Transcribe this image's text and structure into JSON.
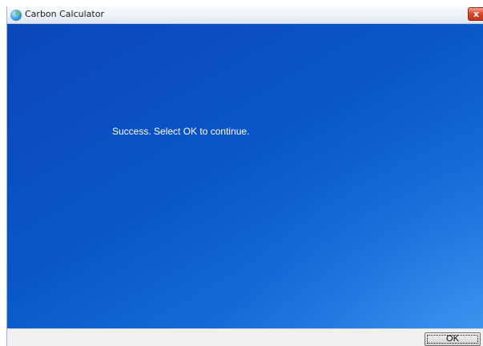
{
  "window": {
    "title": "Carbon Calculator",
    "close_label": "x"
  },
  "content": {
    "message": "Success. Select OK to continue."
  },
  "footer": {
    "ok_label": "OK"
  },
  "colors": {
    "content_background": "#0a56c9",
    "message_text": "#ffffff",
    "close_button": "#d8452a"
  },
  "icons": {
    "app": "globe-icon",
    "close": "close-icon"
  }
}
